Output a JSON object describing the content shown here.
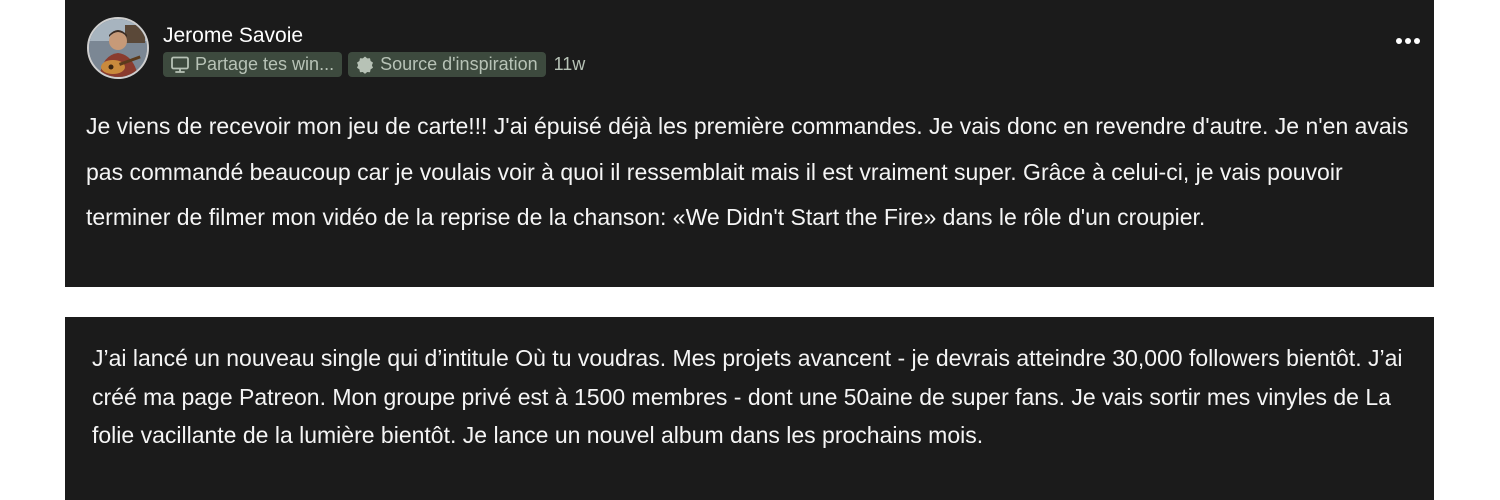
{
  "post": {
    "author": "Jerome Savoie",
    "chips": [
      {
        "label": "Partage tes win...",
        "icon": "monitor-icon"
      },
      {
        "label": "Source d'inspiration",
        "icon": "badge-icon"
      }
    ],
    "time": "11w",
    "body": "Je viens de recevoir mon jeu de carte!!! J'ai épuisé déjà les première commandes. Je vais donc en revendre d'autre. Je n'en avais pas commandé beaucoup car je voulais voir à quoi il ressemblait mais il est vraiment super. Grâce à celui-ci, je vais pouvoir terminer de filmer mon vidéo de la reprise de la chanson: «We Didn't Start the Fire» dans le rôle d'un croupier."
  },
  "note": {
    "body": "J’ai lancé un nouveau single qui d’intitule Où tu voudras. Mes projets avancent - je devrais atteindre 30,000 followers bientôt. J’ai créé ma page Patreon. Mon groupe privé est à 1500 membres - dont une 50aine de super fans. Je vais sortir mes vinyles de La folie vacillante de la lumière bientôt. Je lance un nouvel album dans les prochains mois."
  },
  "colors": {
    "panel": "#1b1b1b",
    "chip_bg": "#3d4a3e",
    "chip_text": "#b7c2b6"
  }
}
